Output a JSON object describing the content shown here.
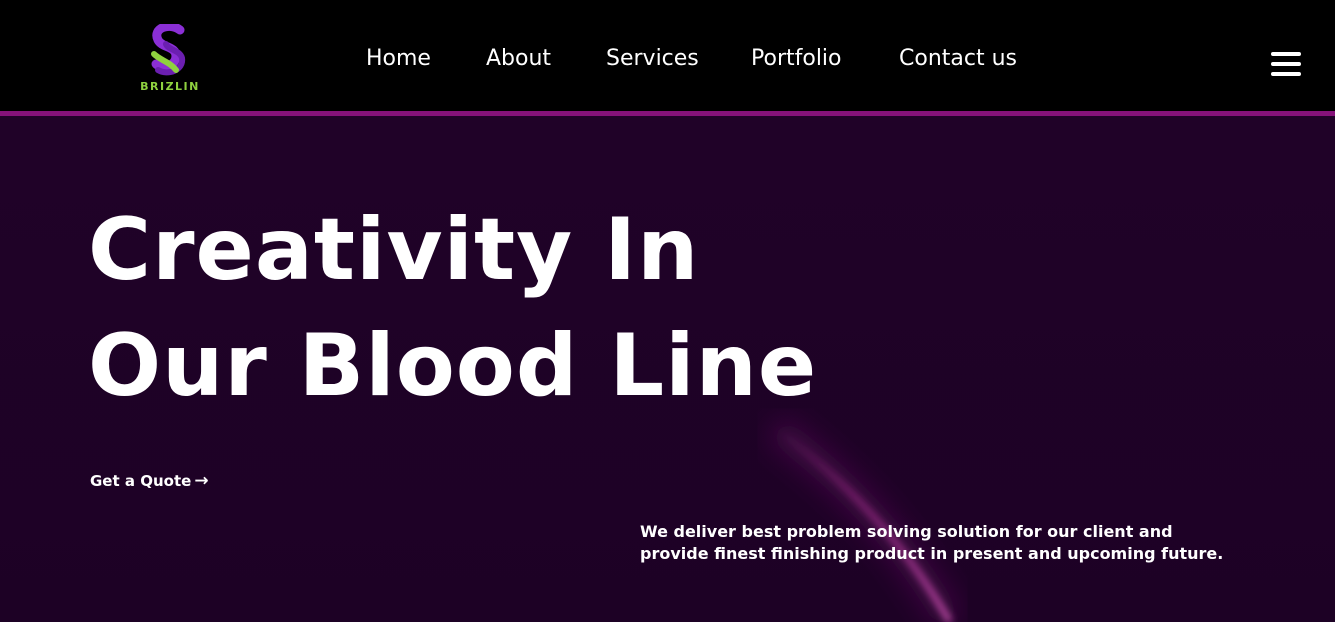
{
  "brand": {
    "name": "BRIZLIN",
    "logo_icon": "brizlin-s-logo-icon",
    "colors": {
      "logo_purple": "#8b2fd6",
      "logo_green": "#8fd13f",
      "accent_border": "#86127a",
      "hero_background": "#1f0126"
    }
  },
  "nav": {
    "items": [
      {
        "label": "Home"
      },
      {
        "label": "About"
      },
      {
        "label": "Services"
      },
      {
        "label": "Portfolio"
      },
      {
        "label": "Contact us"
      }
    ],
    "menu_icon": "hamburger-menu-icon"
  },
  "hero": {
    "title_line1": "Creativity In",
    "title_line2": "Our Blood Line",
    "cta_label": "Get a Quote",
    "cta_icon": "arrow-right-icon",
    "description_line1": "We deliver best problem solving solution for our client and",
    "description_line2": "provide finest finishing product in present and upcoming future."
  }
}
